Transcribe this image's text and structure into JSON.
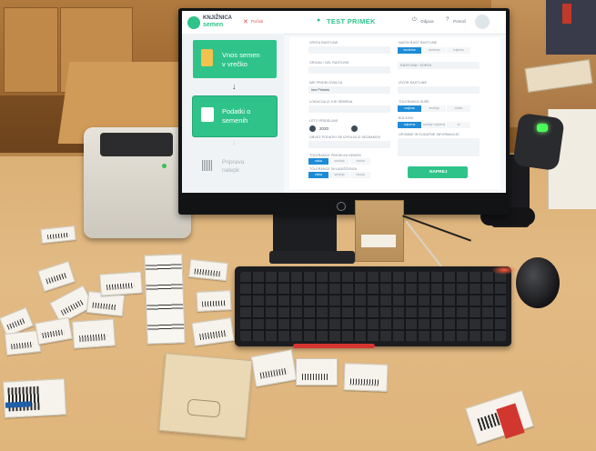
{
  "monitor_ui": {
    "app_logo_line1": "KNJIŽNICA",
    "app_logo_line2": "semen",
    "close_label": "Počisti",
    "page_title": "TEST PRIMEK",
    "logout_label": "Odjava",
    "help_label": "Pomoč",
    "steps": [
      {
        "label_line1": "Vnos semen",
        "label_line2": "v vrečko",
        "state": "done"
      },
      {
        "label_line1": "Podatki o",
        "label_line2": "semenih",
        "state": "active"
      },
      {
        "label_line1": "Priprava",
        "label_line2": "nalepk",
        "state": "pending"
      }
    ],
    "left_column_labels": [
      "VRSTA RASTLINE",
      "ORGAN / DEL RASTLINE",
      "IME PRIDELOVALCA",
      "LOKACIJA IZ KJE SEMENA",
      "LETO PRIDELAVE",
      "OBVEZ PODATKI SE IZPOLNI IZ SEZNAMOV",
      "TOLERANCE PRIDELKA SEMEN",
      "TOLERANCE SKLADIŠČENJA"
    ],
    "grower_name_value": "Ime Priimek",
    "year_value": "2020",
    "right_column_labels": [
      "NAČIN RAST RASTLINE",
      "RASTLINA / SORTA",
      "IZVOR RASTLINE",
      "TOLERANCA SUŠE",
      "BOLEZNI",
      "OPOMBE IN DODATNE INFORMACIJE"
    ],
    "segment_options": {
      "growth": [
        "enoletna",
        "dvoletna",
        "trajnica"
      ],
      "drought": [
        "majhna",
        "srednja",
        "velika"
      ],
      "disease": [
        "odporna",
        "srednje odporna",
        "ni"
      ],
      "tolerance_a": [
        "nizka",
        "srednja",
        "visoka"
      ],
      "tolerance_b": [
        "nizka",
        "srednja",
        "visoka"
      ]
    },
    "next_button_label": "NAPREJ"
  },
  "colors": {
    "accent_green": "#2fc38a",
    "accent_blue": "#1e8bd6",
    "close_red": "#e0504c"
  }
}
